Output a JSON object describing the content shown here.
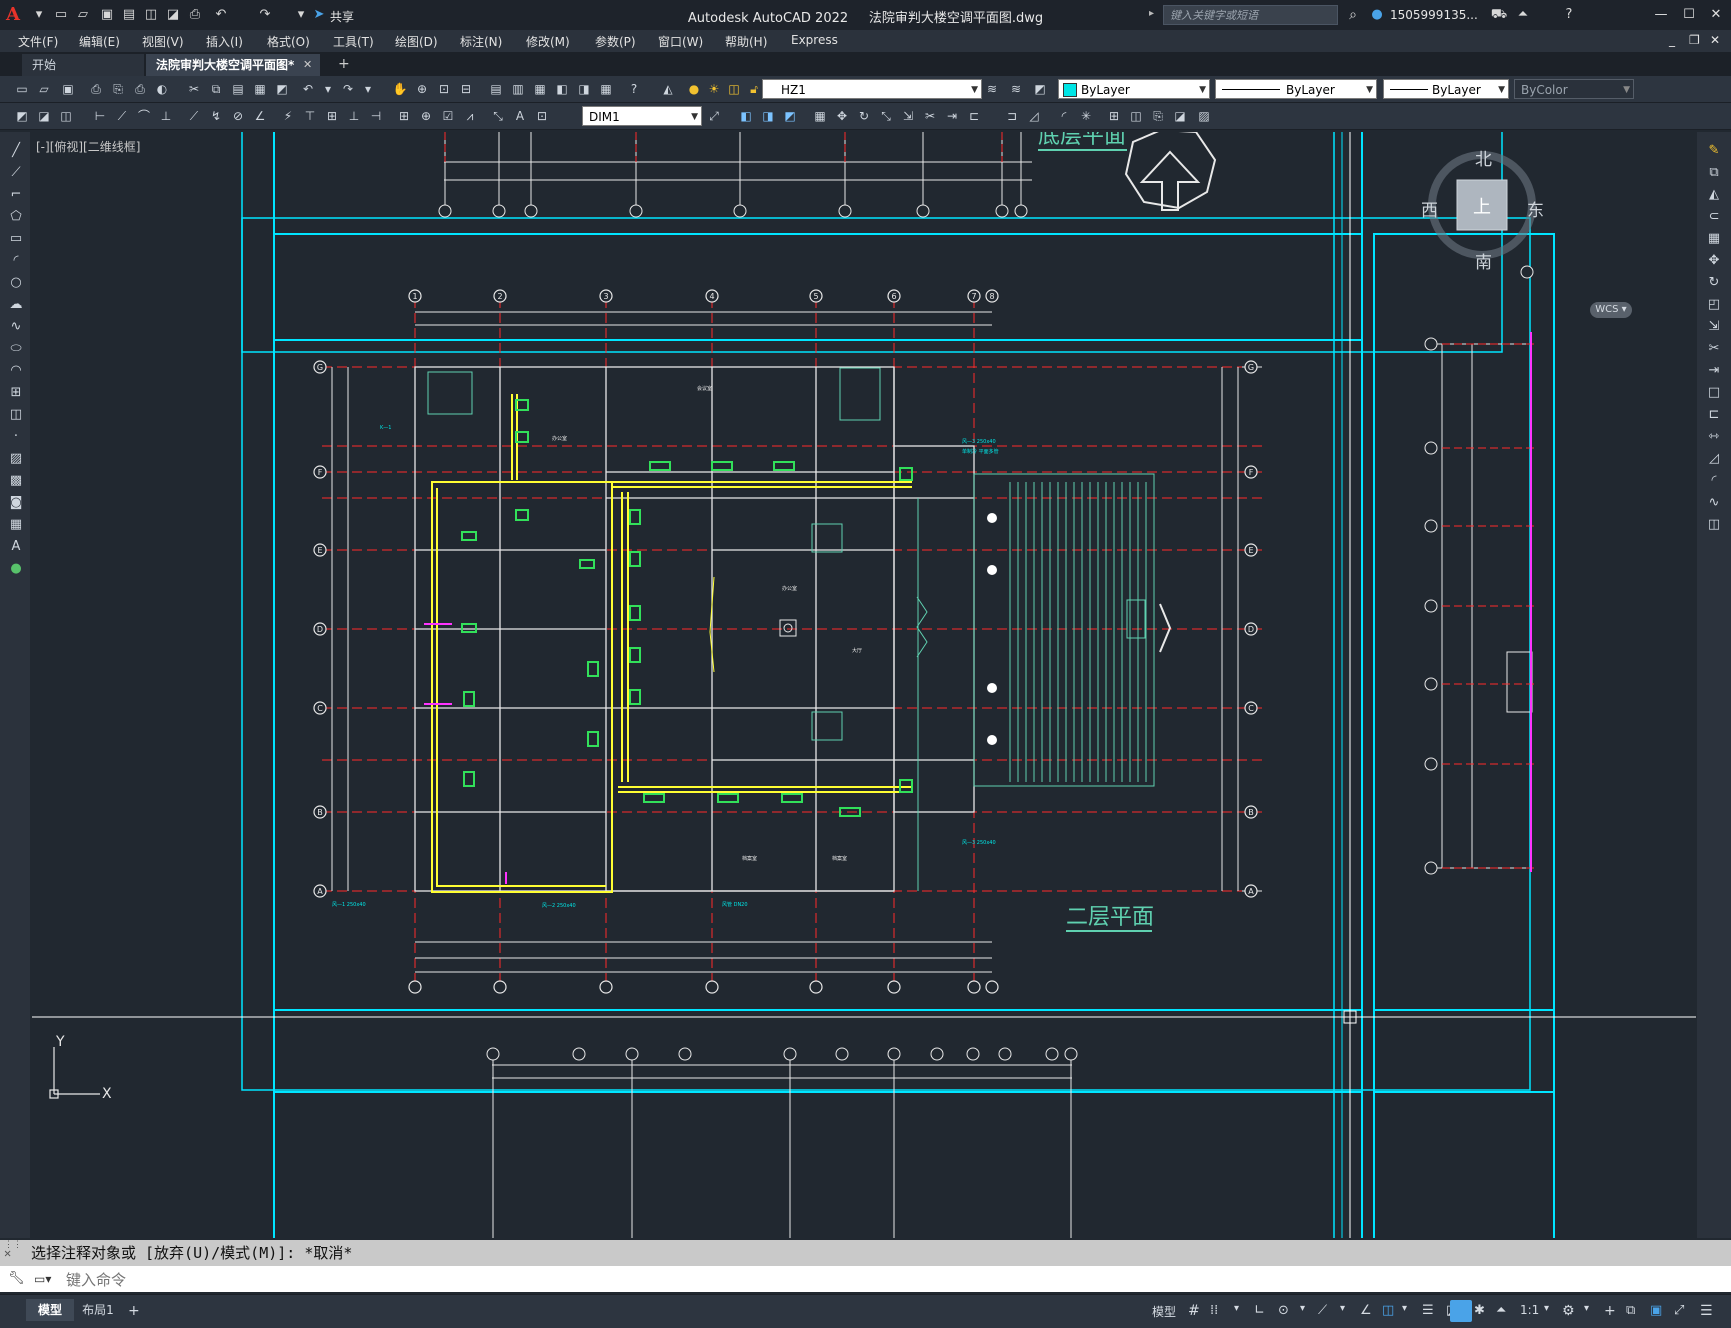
{
  "title_bar": {
    "app_title": "Autodesk AutoCAD 2022",
    "document_title": "法院审判大楼空调平面图.dwg",
    "share_label": "共享",
    "search_placeholder": "键入关键字或短语",
    "user_name": "1505999135..."
  },
  "menu": [
    "文件(F)",
    "编辑(E)",
    "视图(V)",
    "插入(I)",
    "格式(O)",
    "工具(T)",
    "绘图(D)",
    "标注(N)",
    "修改(M)",
    "参数(P)",
    "窗口(W)",
    "帮助(H)",
    "Express"
  ],
  "tabs": {
    "start": "开始",
    "active": "法院审判大楼空调平面图*",
    "add": "+"
  },
  "toolbar": {
    "layer": "HZ1",
    "color": "ByLayer",
    "linetype": "ByLayer",
    "lineweight": "ByLayer",
    "plotstyle": "ByColor",
    "dimstyle": "DIM1"
  },
  "viewport": {
    "label": "[-][俯视][二维线框]"
  },
  "viewcube": {
    "north": "北",
    "south": "南",
    "east": "东",
    "west": "西",
    "top": "上",
    "wcs": "WCS"
  },
  "drawing": {
    "title_top": "底层平面",
    "title_main": "二层平面",
    "grid_cols": [
      "1",
      "2",
      "3",
      "4",
      "5",
      "6",
      "7",
      "8"
    ],
    "grid_rows": [
      "G",
      "F",
      "E",
      "D",
      "C",
      "B",
      "A"
    ]
  },
  "command": {
    "history": "选择注释对象或 [放弃(U)/模式(M)]: *取消*",
    "placeholder": "键入命令"
  },
  "status": {
    "layout_tabs": [
      "模型",
      "布局1"
    ],
    "model_label": "模型",
    "scale": "1:1"
  }
}
